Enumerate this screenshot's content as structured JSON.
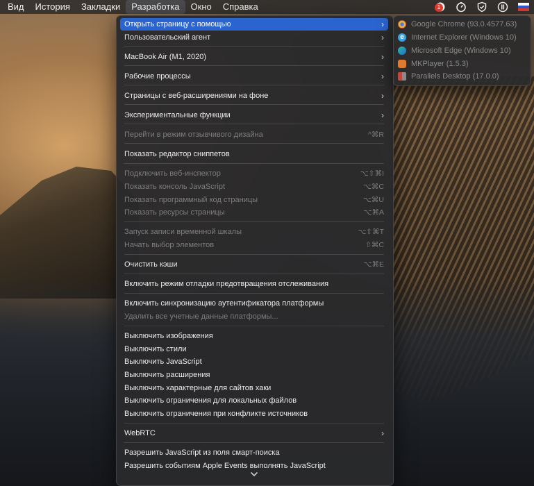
{
  "menubar": {
    "items": [
      "Вид",
      "История",
      "Закладки",
      "Разработка",
      "Окно",
      "Справка"
    ],
    "active_index": 3,
    "badge": "1"
  },
  "menu": {
    "items": [
      {
        "label": "Открыть страницу с помощью",
        "submenu": true,
        "highlighted": true
      },
      {
        "label": "Пользовательский агент",
        "submenu": true
      },
      {
        "label": "MacBook Air (M1, 2020)",
        "submenu": true
      },
      {
        "label": "Рабочие процессы",
        "submenu": true
      },
      {
        "label": "Страницы с веб-расширениями на фоне",
        "submenu": true
      },
      {
        "label": "Экспериментальные функции",
        "submenu": true
      },
      {
        "label": "Перейти в режим отзывчивого дизайна",
        "shortcut": "^⌘R",
        "disabled": true
      },
      {
        "label": "Показать редактор сниппетов"
      },
      {
        "label": "Подключить веб-инспектор",
        "shortcut": "⌥⇧⌘I",
        "disabled": true
      },
      {
        "label": "Показать консоль JavaScript",
        "shortcut": "⌥⌘C",
        "disabled": true
      },
      {
        "label": "Показать программный код страницы",
        "shortcut": "⌥⌘U",
        "disabled": true
      },
      {
        "label": "Показать ресурсы страницы",
        "shortcut": "⌥⌘A",
        "disabled": true
      },
      {
        "label": "Запуск записи временной шкалы",
        "shortcut": "⌥⇧⌘T",
        "disabled": true
      },
      {
        "label": "Начать выбор элементов",
        "shortcut": "⇧⌘C",
        "disabled": true
      },
      {
        "label": "Очистить кэши",
        "shortcut": "⌥⌘E"
      },
      {
        "label": "Включить режим отладки предотвращения отслеживания"
      },
      {
        "label": "Включить синхронизацию аутентификатора платформы"
      },
      {
        "label": "Удалить все учетные данные платформы...",
        "disabled": true
      },
      {
        "label": "Выключить изображения"
      },
      {
        "label": "Выключить стили"
      },
      {
        "label": "Выключить JavaScript"
      },
      {
        "label": "Выключить расширения"
      },
      {
        "label": "Выключить характерные для сайтов хаки"
      },
      {
        "label": "Выключить ограничения для локальных файлов"
      },
      {
        "label": "Выключить ограничения при конфликте источников"
      },
      {
        "label": "WebRTC",
        "submenu": true
      },
      {
        "label": "Разрешить JavaScript из поля смарт-поиска"
      },
      {
        "label": "Разрешить событиям Apple Events выполнять JavaScript"
      }
    ]
  },
  "submenu": {
    "items": [
      {
        "label": "Google Chrome (93.0.4577.63)",
        "icon": "chrome-icon",
        "color": "#e9b23a"
      },
      {
        "label": "Internet Explorer (Windows 10)",
        "icon": "internet-explorer-icon",
        "color": "#3aa3e0"
      },
      {
        "label": "Microsoft Edge (Windows 10)",
        "icon": "edge-icon",
        "color": "#2fb9a0"
      },
      {
        "label": "MKPlayer (1.5.3)",
        "icon": "mkplayer-icon",
        "color": "#e07a2e"
      },
      {
        "label": "Parallels Desktop (17.0.0)",
        "icon": "parallels-icon",
        "color": "#c8453a"
      }
    ]
  },
  "colors": {
    "highlight": "#2c64cf",
    "menu_bg": "#2a2a2c"
  }
}
